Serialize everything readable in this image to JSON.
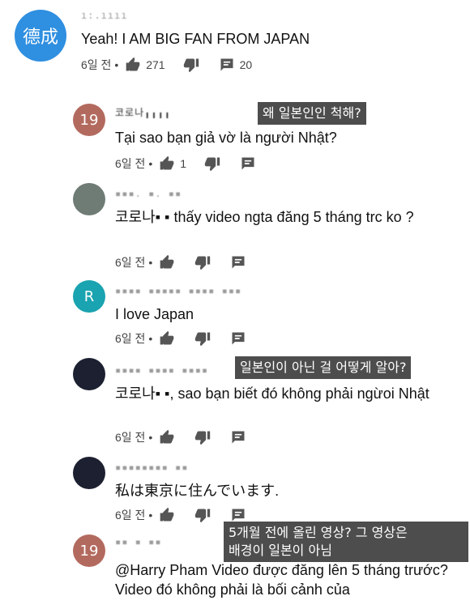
{
  "comments": [
    {
      "avatar_text": "德成",
      "avatar_color": "#2f8fe0",
      "name": "ı:.ıııı",
      "text": "Yeah! I AM BIG FAN FROM JAPAN",
      "time": "6일 전 •",
      "likes": "271",
      "replies": "20"
    },
    {
      "avatar_text": "19",
      "avatar_color": "#b36a5e",
      "name": "코로나╻╻╻╻",
      "text": "Tại sao bạn giả vờ là người Nhật?",
      "time": "6일 전 •",
      "likes": "1"
    },
    {
      "avatar_text": "",
      "avatar_color": "#6f7b75",
      "name": "▪▪▪. ▪. ▪▪",
      "text": "코로나▪ ▪ thấy video ngta đăng 5 tháng trc ko ?",
      "time": "6일 전 •"
    },
    {
      "avatar_text": "R",
      "avatar_color": "#1aa3b0",
      "name": "▪▪▪▪ ▪▪▪▪▪ ▪▪▪▪ ▪▪▪",
      "text": "I love Japan",
      "time": "6일 전 •"
    },
    {
      "avatar_text": "",
      "avatar_color": "#1c2030",
      "name": "▪▪▪▪ ▪▪▪▪ ▪▪▪▪",
      "text": "코로나▪ ▪, sao bạn biết đó không phải ngừoi Nhật",
      "time": "6일 전 •"
    },
    {
      "avatar_text": "",
      "avatar_color": "#1c2030",
      "name": "▪▪▪▪▪▪▪▪ ▪▪",
      "text": "私は東京に住んでいます.",
      "time": "6일 전 •"
    },
    {
      "avatar_text": "19",
      "avatar_color": "#b36a5e",
      "name": "▪▪ ▪ ▪▪",
      "text": "@Harry Pham Video được đăng lên 5 tháng trước? Video đó không phải là bối cảnh của"
    }
  ],
  "overlays": {
    "o1": "왜 일본인인 척해?",
    "o2": "일본인이 아닌 걸 어떻게 알아?",
    "o3_line1": "5개월 전에 올린 영상? 그 영상은",
    "o3_line2": "배경이 일본이 아님"
  },
  "icons": {
    "like": "thumbs-up-icon",
    "dislike": "thumbs-down-icon",
    "reply": "reply-icon"
  }
}
